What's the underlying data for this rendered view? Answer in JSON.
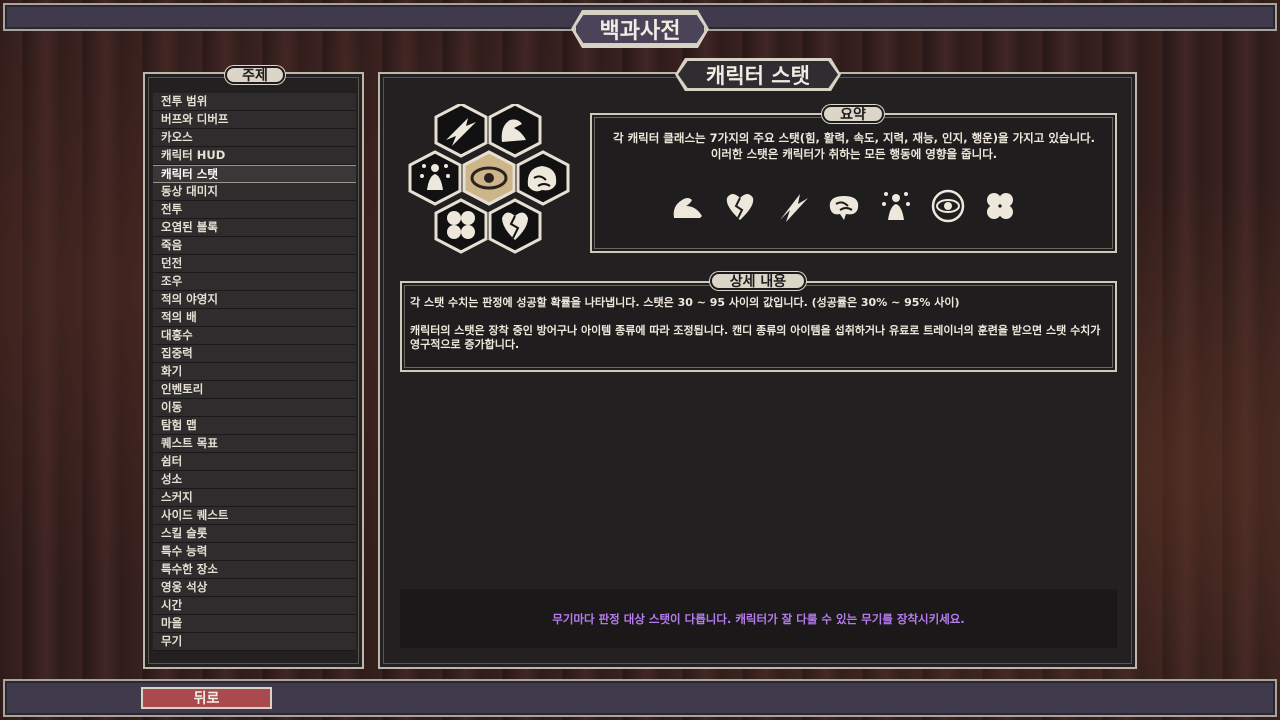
{
  "window": {
    "title": "백과사전"
  },
  "topics": {
    "header": "주제",
    "items": [
      "전투 범위",
      "버프와 디버프",
      "카오스",
      "캐릭터 HUD",
      "캐릭터 스탯",
      "동상 대미지",
      "전투",
      "오염된 블록",
      "죽음",
      "던전",
      "조우",
      "적의 야영지",
      "적의 배",
      "대홍수",
      "집중력",
      "화기",
      "인벤토리",
      "이동",
      "탐험 맵",
      "퀘스트 목표",
      "쉼터",
      "성소",
      "스커지",
      "사이드 퀘스트",
      "스킬 슬롯",
      "특수 능력",
      "특수한 장소",
      "영웅 석상",
      "시간",
      "마을",
      "무기"
    ],
    "selected_index": 4
  },
  "article": {
    "title": "캐릭터 스탯",
    "summary_header": "요약",
    "summary_line1": "각 캐릭터 클래스는 7가지의 주요 스탯(힘, 활력, 속도, 지력, 재능, 인지, 행운)을 가지고 있습니다.",
    "summary_line2": "이러한 스탯은 캐릭터가 취하는 모든 행동에 영향을 줍니다.",
    "stat_icons": [
      "strength-icon",
      "vitality-icon",
      "speed-icon",
      "intellect-icon",
      "talent-icon",
      "perception-icon",
      "luck-icon"
    ],
    "details_header": "상세 내용",
    "details_p1": "각 스탯 수치는 판정에 성공할 확률을 나타냅니다. 스탯은 30 ~ 95 사이의 값입니다. (성공률은 30% ~ 95% 사이)",
    "details_p2": "캐릭터의 스탯은 장착 중인 방어구나 아이템 종류에 따라 조정됩니다. 캔디 종류의 아이템을 섭취하거나 유료로 트레이너의 훈련을 받으면 스탯 수치가 영구적으로 증가합니다.",
    "tip": "무기마다 판정 대상 스탯이 다릅니다. 캐릭터가 잘 다룰 수 있는 무기를 장착시키세요."
  },
  "footer": {
    "back_label": "뒤로"
  },
  "colors": {
    "accent_tip": "#b77bf0",
    "back_button": "#a84a4e",
    "panel": "#222020",
    "frame": "#3f3b4d"
  }
}
